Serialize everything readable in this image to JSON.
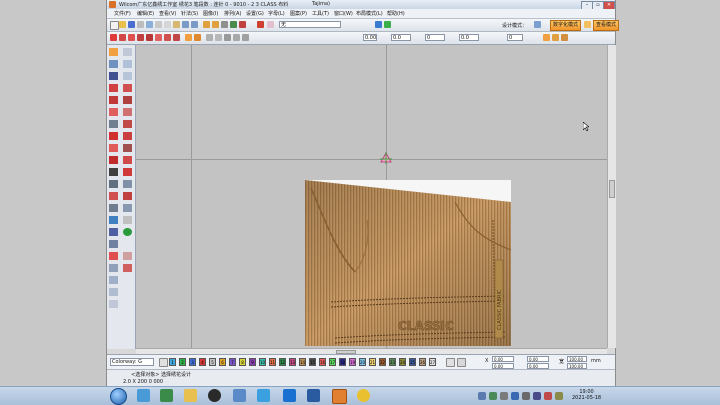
{
  "window": {
    "title": "Wilcom广东亿鑫绣工作室  绣花3 笔段数 : 连针 0 - 9010 - 2 3 CLASS 布料",
    "title_right": "Tajima)"
  },
  "menu": {
    "items": [
      "文件(F)",
      "编辑(E)",
      "查看(V)",
      "针法(S)",
      "图像(I)",
      "排列(A)",
      "设置(G)",
      "字母(L)",
      "图案(P)",
      "工具(T)",
      "窗口(W)",
      "布局模式(L)",
      "帮助(H)"
    ]
  },
  "toolbar1": {
    "font_field": "无",
    "design_mode_label": "设计模式：",
    "mode_button": "数字化模式",
    "view_button": "查看模式"
  },
  "toolbar2": {
    "fields": [
      "0.00",
      "0.0",
      "0",
      "0.0",
      "0"
    ]
  },
  "colorbar": {
    "colorway_label": "Colorway: G",
    "swatches": [
      "1",
      "2",
      "3",
      "4",
      "5",
      "6",
      "7",
      "8",
      "9",
      "10",
      "11",
      "12",
      "13",
      "14",
      "15",
      "16",
      "17",
      "18",
      "19",
      "20",
      "21",
      "22",
      "23",
      "24",
      "25",
      "26",
      "27"
    ],
    "swatch_colors": [
      "#3fa9e0",
      "#2fb34a",
      "#3f6fd6",
      "#d83a3a",
      "#c3c3c3",
      "#e3a72c",
      "#7a56c9",
      "#d6d63a",
      "#8c3fae",
      "#3dc0b0",
      "#e4704a",
      "#2d8a4a",
      "#c44a88",
      "#bb8f54",
      "#4c4c4c",
      "#e45c5c",
      "#5cd65c",
      "#2c2c8c",
      "#d66cd6",
      "#7bc0e6",
      "#f0d070",
      "#a05c2c",
      "#5c8c5c",
      "#8c8c3c",
      "#3c5ca0",
      "#c0a080",
      "#e0e0e0"
    ],
    "coords": {
      "x_label": "X",
      "x_value": "0.00",
      "y_value": "0.00",
      "w_label": "宽",
      "w_value": "100.00",
      "h_value": "100.00",
      "unit": "mm"
    }
  },
  "statusbar": {
    "text": "<选择对象>  选择绣花设计",
    "coord_text": "2.0 X 200 0 000"
  },
  "taskbar": {
    "clock_time": "19:00",
    "clock_date": "2021-05-18"
  }
}
